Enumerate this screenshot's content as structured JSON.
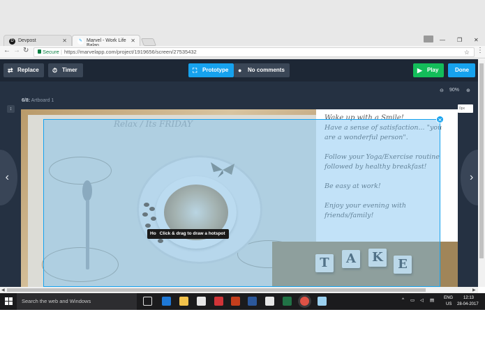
{
  "browser": {
    "tabs": [
      {
        "label": "Devpost",
        "active": false,
        "icon": "devpost-icon"
      },
      {
        "label": "Marvel - Work Life Balan",
        "active": true,
        "icon": "marvel-icon"
      }
    ],
    "window_controls": [
      "minimize-icon",
      "restore-icon",
      "close-icon"
    ],
    "address": {
      "secure_label": "Secure",
      "url": "https://marvelapp.com/project/1919656/screen/27535432"
    }
  },
  "app": {
    "toolbar": {
      "replace_label": "Replace",
      "timer_label": "Timer",
      "prototype_label": "Prototype",
      "comments_label": "No comments",
      "play_label": "Play",
      "done_label": "Done"
    },
    "zoom_label": "90%",
    "artboard_counter": "6/8:",
    "artboard_name": "Artboard 1",
    "right_chip": "0px",
    "tooltip": {
      "prefix": "Ho",
      "text": "Click & drag to draw a hotspot"
    },
    "artboard": {
      "left_caption": "Relax / Its FRIDAY",
      "message": {
        "title": "Wake up with a Smile!",
        "line1": "Have a sense of satisfaction... \"you are a wonderful person\".",
        "line2": "Follow your Yoga/Exercise routine followed by healthy breakfast!",
        "line3": "Be easy at work!",
        "line4": "Enjoy your evening with friends/family!"
      },
      "tiles": [
        "T",
        "A",
        "K",
        "E"
      ]
    },
    "colors": {
      "accent": "#16a2ee",
      "play_green": "#13bd5a",
      "toolbar_bg": "#1d2735",
      "canvas_bg": "#253142"
    }
  },
  "taskbar": {
    "search_placeholder": "Search the web and Windows",
    "lang_top": "ENG",
    "lang_bottom": "US",
    "time": "12:13",
    "date": "28-04-2017",
    "apps": [
      "task-view-icon",
      "edge-icon",
      "file-explorer-icon",
      "store-icon",
      "mail-icon",
      "powerpoint-icon",
      "word-icon",
      "paint-icon",
      "excel-icon",
      "chrome-icon",
      "photos-icon"
    ]
  }
}
